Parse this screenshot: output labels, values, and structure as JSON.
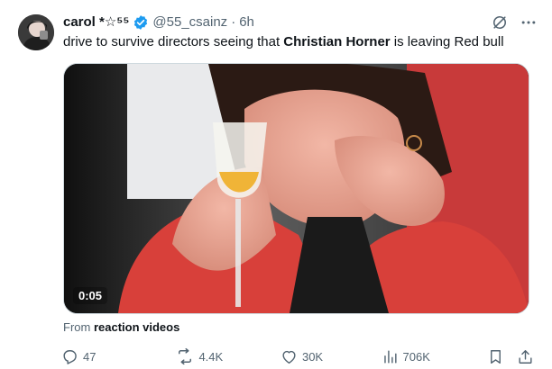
{
  "tweet": {
    "author": {
      "display_name": "carol *☆⁵⁵",
      "handle": "@55_csainz",
      "verified": true
    },
    "separator": "·",
    "time": "6h",
    "text_before": "drive to survive directors seeing that ",
    "text_bold": "Christian Horner",
    "text_after": " is leaving Red bull",
    "media": {
      "type": "video",
      "duration": "0:05"
    },
    "source_prefix": "From ",
    "source_name": "reaction videos",
    "stats": {
      "replies": "47",
      "reposts": "4.4K",
      "likes": "30K",
      "views": "706K"
    }
  },
  "colors": {
    "verified_blue": "#1d9bf0",
    "secondary_text": "#536471",
    "primary_text": "#0f1419"
  },
  "icons": [
    "grok-icon",
    "more-icon",
    "reply-icon",
    "repost-icon",
    "like-icon",
    "views-icon",
    "bookmark-icon",
    "share-icon",
    "verified-badge-icon"
  ]
}
